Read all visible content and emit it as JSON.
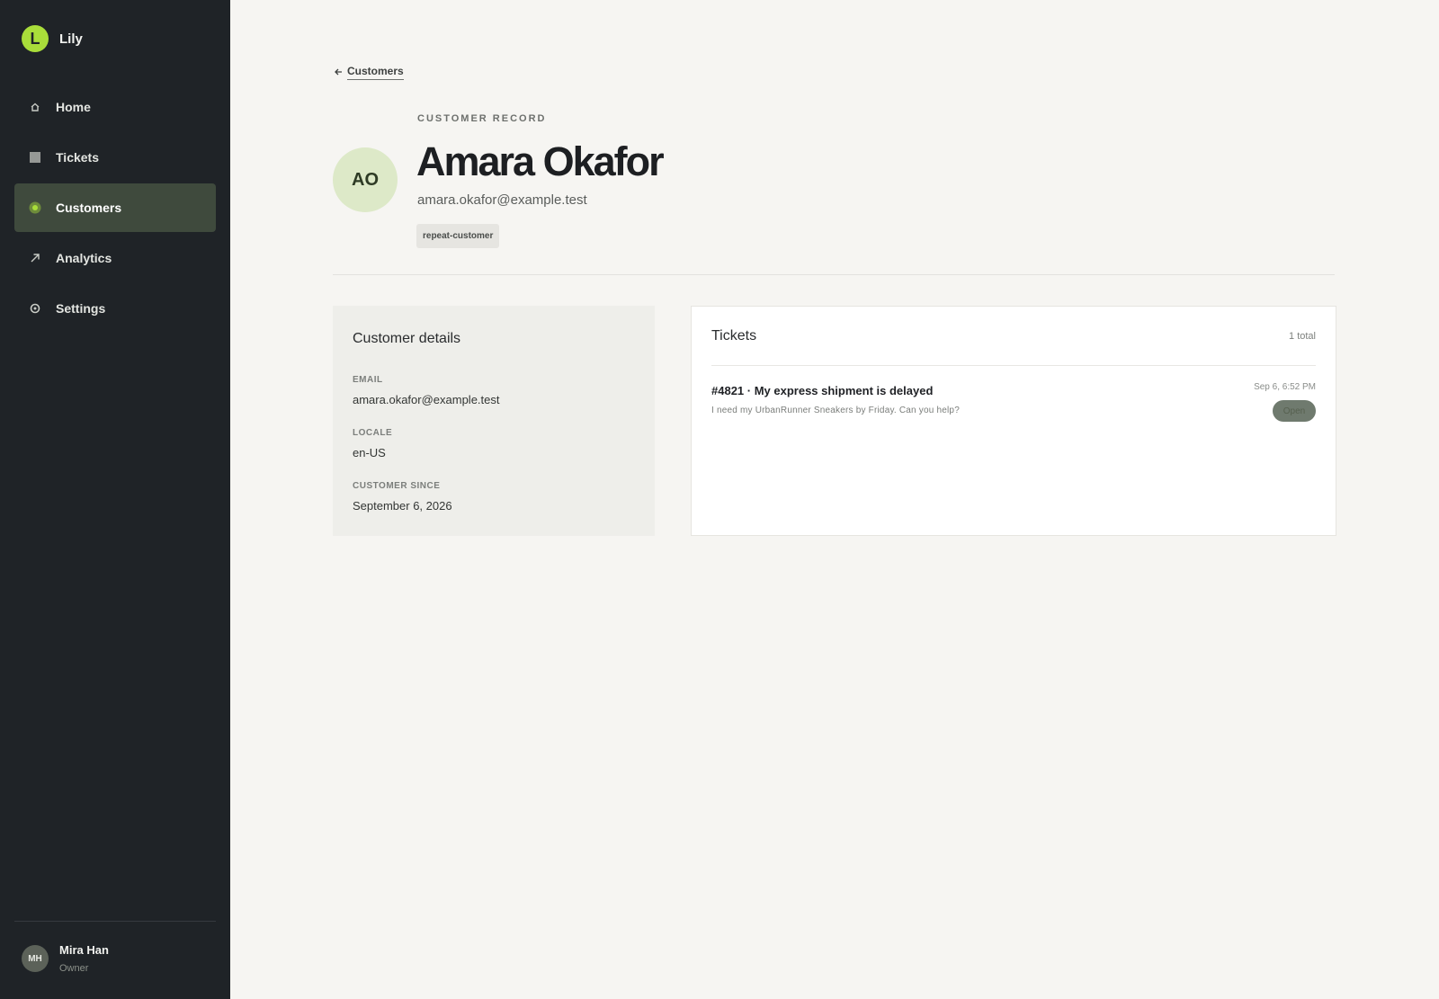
{
  "app": {
    "name": "Lily",
    "logo_letter": "L",
    "brand_color": "#a9dd3a"
  },
  "sidebar": {
    "items": [
      {
        "label": "Home",
        "icon": "home-icon",
        "active": false
      },
      {
        "label": "Tickets",
        "icon": "ticket-icon",
        "active": false
      },
      {
        "label": "Customers",
        "icon": "customers-icon",
        "active": true
      },
      {
        "label": "Analytics",
        "icon": "analytics-icon",
        "active": false
      },
      {
        "label": "Settings",
        "icon": "gear-icon",
        "active": false
      }
    ],
    "user": {
      "initials": "MH",
      "name": "Mira Han",
      "role": "Owner"
    }
  },
  "breadcrumb": {
    "label": "Customers",
    "icon": "arrow-left-icon"
  },
  "customer": {
    "eyebrow": "CUSTOMER RECORD",
    "initials": "AO",
    "name": "Amara Okafor",
    "email": "amara.okafor@example.test",
    "tag": "repeat-customer"
  },
  "details": {
    "title": "Customer details",
    "email_label": "EMAIL",
    "email_value": "amara.okafor@example.test",
    "locale_label": "LOCALE",
    "locale_value": "en-US",
    "since_label": "CUSTOMER SINCE",
    "since_value": "September 6, 2026"
  },
  "tickets": {
    "title": "Tickets",
    "count": "1 total",
    "items": [
      {
        "title": "#4821 · My express shipment is delayed",
        "snippet": "I need my UrbanRunner Sneakers by Friday. Can you help?",
        "date": "Sep 6, 6:52 PM",
        "status": "Open"
      }
    ]
  }
}
